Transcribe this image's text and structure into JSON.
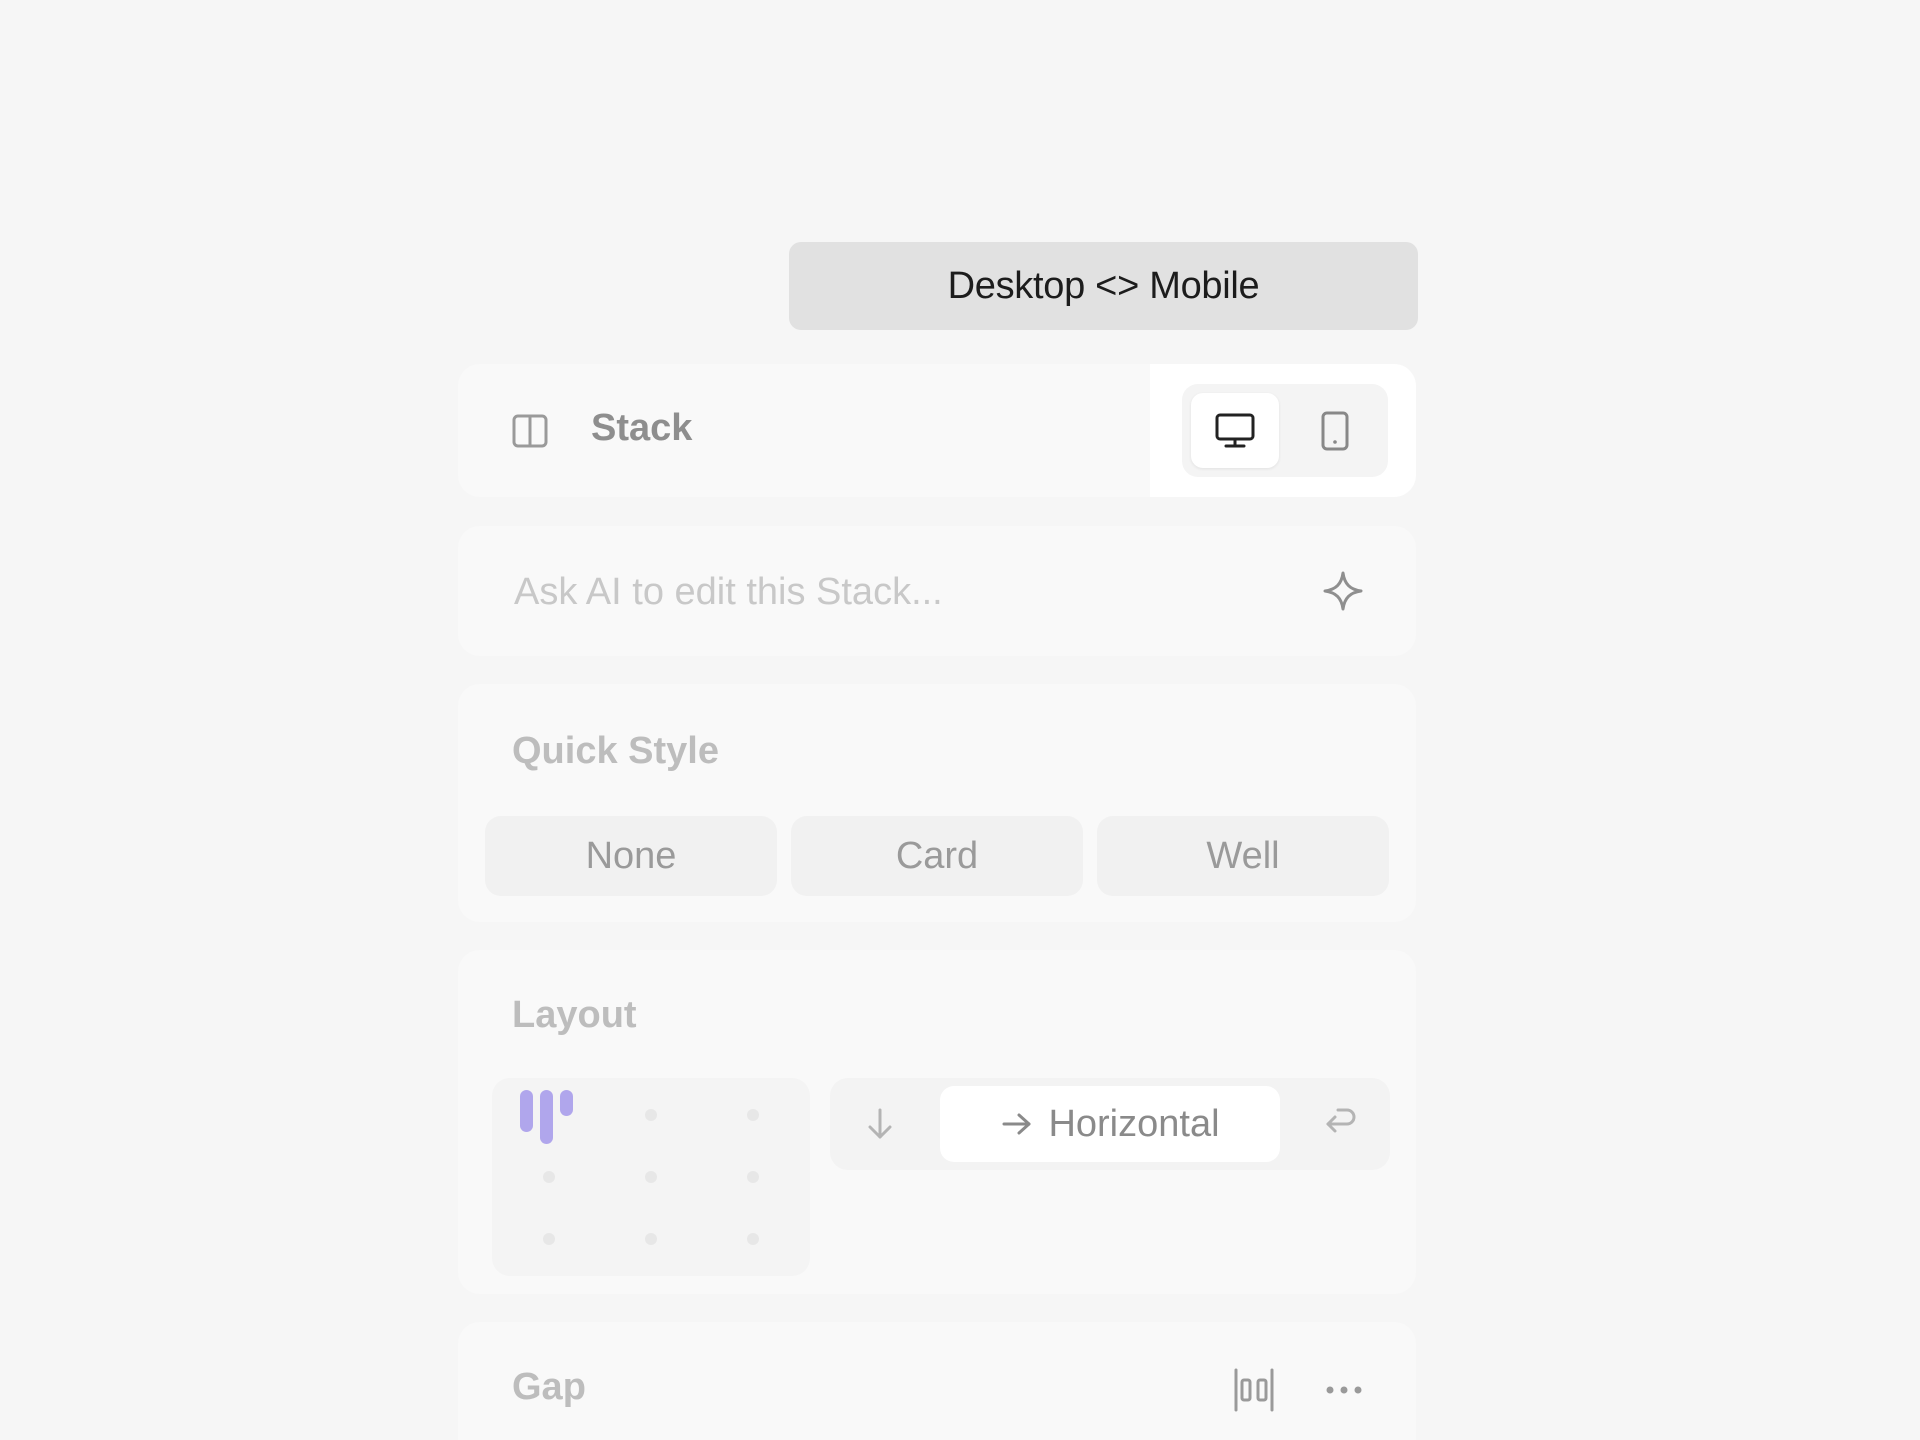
{
  "tooltip": {
    "text": "Desktop <> Mobile"
  },
  "header": {
    "title": "Stack",
    "icons": {
      "panel": "columns-panel-icon",
      "desktop": "monitor-icon",
      "mobile": "phone-icon"
    },
    "active_device": "desktop"
  },
  "ai": {
    "placeholder": "Ask AI to edit this Stack...",
    "icon": "sparkle-icon"
  },
  "quick_style": {
    "title": "Quick Style",
    "options": [
      "None",
      "Card",
      "Well"
    ]
  },
  "layout": {
    "title": "Layout",
    "direction_selected": "Horizontal",
    "icons": {
      "vertical": "arrow-down-icon",
      "horizontal": "arrow-right-icon",
      "wrap": "wrap-arrow-icon"
    },
    "accent_color": "#b0a6ec"
  },
  "gap": {
    "title": "Gap",
    "icons": {
      "distribute": "distribute-gap-icon",
      "more": "more-dots-icon"
    }
  }
}
